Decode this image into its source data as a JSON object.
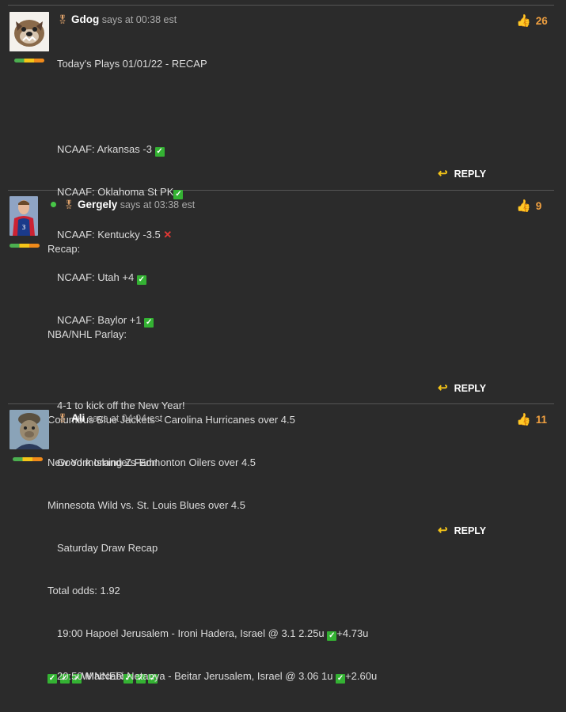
{
  "comments": [
    {
      "author": "Gdog",
      "says": "says",
      "time": "at 00:38 est",
      "likes": "26",
      "reply_label": "REPLY",
      "lines": [
        "Today's Plays 01/01/22 - RECAP",
        "",
        "NCAAF: Arkansas -3 ✅",
        "NCAAF: Oklahoma St PK✅",
        "NCAAF: Kentucky -3.5 ❌",
        "NCAAF: Utah +4 ✅",
        "NCAAF: Baylor +1 ✅",
        "",
        "4-1 to kick off the New Year!"
      ]
    },
    {
      "author": "Gergely",
      "says": "says",
      "time": "at 03:38 est",
      "likes": "9",
      "reply_label": "REPLY",
      "lines": [
        "Recap:",
        "",
        "NBA/NHL Parlay:",
        "",
        "Columbus Blue Jackets - Carolina Hurricanes over 4.5",
        "New York Islanders-Edmonton Oilers over 4.5",
        "Minnesota Wild vs. St. Louis Blues over 4.5",
        "",
        "Total odds: 1.92",
        "",
        "✅ ✅ ✅WINNER✅ ✅ ✅"
      ]
    },
    {
      "author": "Ali",
      "says": "says",
      "time": "at 04:04 est",
      "likes": "11",
      "reply_label": "REPLY",
      "lines": [
        "Good morning Z Fam!",
        "",
        "Saturday Draw Recap",
        "",
        "19:00 Hapoel Jerusalem - Ironi Hadera, Israel @ 3.1 2.25u ✅+4.73u",
        "20:50 Maccabi Netanya - Beitar Jerusalem, Israel @ 3.06 1u ✅+2.60u"
      ]
    }
  ],
  "colors": {
    "background": "#2b2b2b",
    "likes": "#f0a040",
    "reply_arrow": "#f5c518",
    "check": "#34b233",
    "cross": "#e53935"
  }
}
